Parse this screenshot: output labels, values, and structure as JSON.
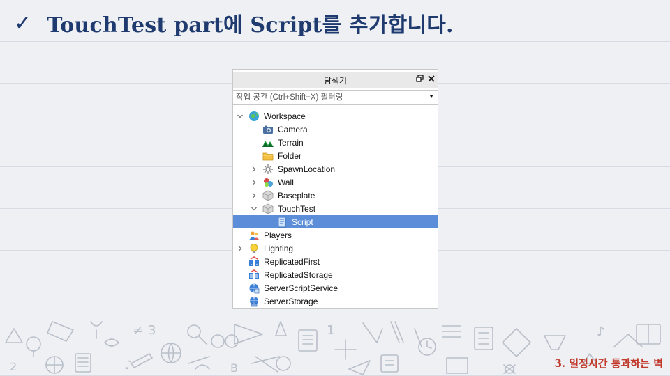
{
  "slide": {
    "check_glyph": "✓",
    "title": "TouchTest part에 Script를 추가합니다.",
    "footer": "3. 일정시간 통과하는 벽"
  },
  "explorer": {
    "title": "탐색기",
    "filter_placeholder": "작업 공간 (Ctrl+Shift+X) 필터링",
    "tree": [
      {
        "label": "Workspace",
        "icon": "workspace-globe-icon",
        "expander": "expanded",
        "level": 0
      },
      {
        "label": "Camera",
        "icon": "camera-icon",
        "expander": "none",
        "level": 1
      },
      {
        "label": "Terrain",
        "icon": "terrain-icon",
        "expander": "none",
        "level": 1
      },
      {
        "label": "Folder",
        "icon": "folder-icon",
        "expander": "none",
        "level": 1
      },
      {
        "label": "SpawnLocation",
        "icon": "spawn-location-icon",
        "expander": "collapsed",
        "level": 1
      },
      {
        "label": "Wall",
        "icon": "model-icon",
        "expander": "collapsed",
        "level": 1
      },
      {
        "label": "Baseplate",
        "icon": "part-icon",
        "expander": "collapsed",
        "level": 1
      },
      {
        "label": "TouchTest",
        "icon": "part-icon",
        "expander": "expanded",
        "level": 1
      },
      {
        "label": "Script",
        "icon": "script-icon",
        "expander": "none",
        "level": 2,
        "selected": true
      },
      {
        "label": "Players",
        "icon": "players-icon",
        "expander": "none",
        "level": 0
      },
      {
        "label": "Lighting",
        "icon": "lightbulb-icon",
        "expander": "collapsed",
        "level": 0
      },
      {
        "label": "ReplicatedFirst",
        "icon": "replicated-first-icon",
        "expander": "none",
        "level": 0
      },
      {
        "label": "ReplicatedStorage",
        "icon": "replicated-storage-icon",
        "expander": "none",
        "level": 0
      },
      {
        "label": "ServerScriptService",
        "icon": "server-script-service-icon",
        "expander": "none",
        "level": 0
      },
      {
        "label": "ServerStorage",
        "icon": "server-storage-icon",
        "expander": "none",
        "level": 0
      }
    ]
  },
  "colors": {
    "title": "#1f3a6e",
    "footer": "#c0392b",
    "selection": "#5b8dd8"
  }
}
